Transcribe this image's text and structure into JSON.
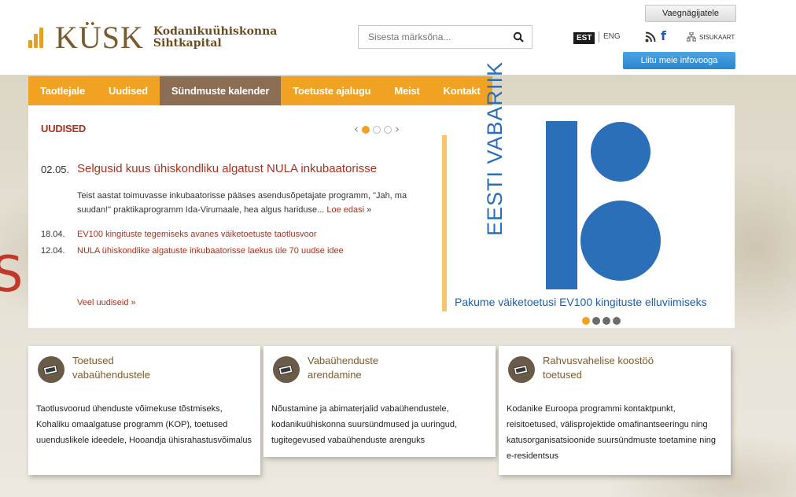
{
  "header": {
    "logo_text": "KÜSK",
    "logo_subtitle_line1": "Kodanikuühiskonna",
    "logo_subtitle_line2": "Sihtkapital",
    "search_placeholder": "Sisesta märksõna...",
    "lang_est": "EST",
    "lang_eng": "ENG",
    "sitemap_label": "SISUKAART",
    "btn_vaegnagijatele": "Vaegnägijatele",
    "btn_liitu": "Liitu meie infovooga"
  },
  "nav": {
    "items": [
      {
        "label": "Taotlejale"
      },
      {
        "label": "Uudised"
      },
      {
        "label": "Sündmuste kalender"
      },
      {
        "label": "Toetuste ajalugu"
      },
      {
        "label": "Meist"
      },
      {
        "label": "Kontakt"
      }
    ],
    "active_index": 2
  },
  "news": {
    "section_title": "UUDISED",
    "main": {
      "date": "02.05.",
      "title": "Selgusid kuus ühiskondliku algatust NULA inkubaatorisse",
      "text": "Teist aastat toimuvasse inkubaatorisse pääses asendusõpetajate programm, \"Jah, ma suudan!\" praktikaprogramm Ida-Virumaale, hea algus hariduse...",
      "more_label": "Loe edasi",
      "more_arrow": "»"
    },
    "items": [
      {
        "date": "18.04.",
        "title": "EV100 kingituste tegemiseks avanes väiketoetuste taotlusvoor"
      },
      {
        "date": "12.04.",
        "title": "NULA ühiskondlike algatuste inkubaatorisse laekus üle 70 uudse idee"
      }
    ],
    "all_news_label": "Veel uudiseid »"
  },
  "promo": {
    "vertical_text": "EESTI VABARIIK",
    "caption": "Pakume väiketoetusi EV100 kingituste elluviimiseks"
  },
  "cards": [
    {
      "title_line1": "Toetused",
      "title_line2": "vabaühendustele",
      "body": "Taotlusvoorud ühenduste võimekuse tõstmiseks, Kohaliku omaalgatuse programm (KOP), toetused uuenduslikele ideedele, Hooandja ühisrahastusvõimalus"
    },
    {
      "title_line1": "Vabaühenduste",
      "title_line2": "arendamine",
      "body": "Nõustamine ja abimaterjalid vabaühendustele, kodanikuühiskonna suursündmused ja uuringud, tugitegevused vabaühenduste arenguks"
    },
    {
      "title_line1": "Rahvusvahelise koostöö",
      "title_line2": "toetused",
      "body": "Kodanike Euroopa programmi kontaktpunkt, reisitoetused, välisprojektide omafinantseeringu ning katusorganisatsioonide suursündmuste toetamine ning e-residentsus"
    }
  ],
  "colors": {
    "nav_orange": "#f2a223",
    "nav_active": "#8a6d52",
    "news_red": "#a8311f",
    "ev_blue": "#2a6fb8",
    "liitu_blue": "#2b86cc"
  }
}
